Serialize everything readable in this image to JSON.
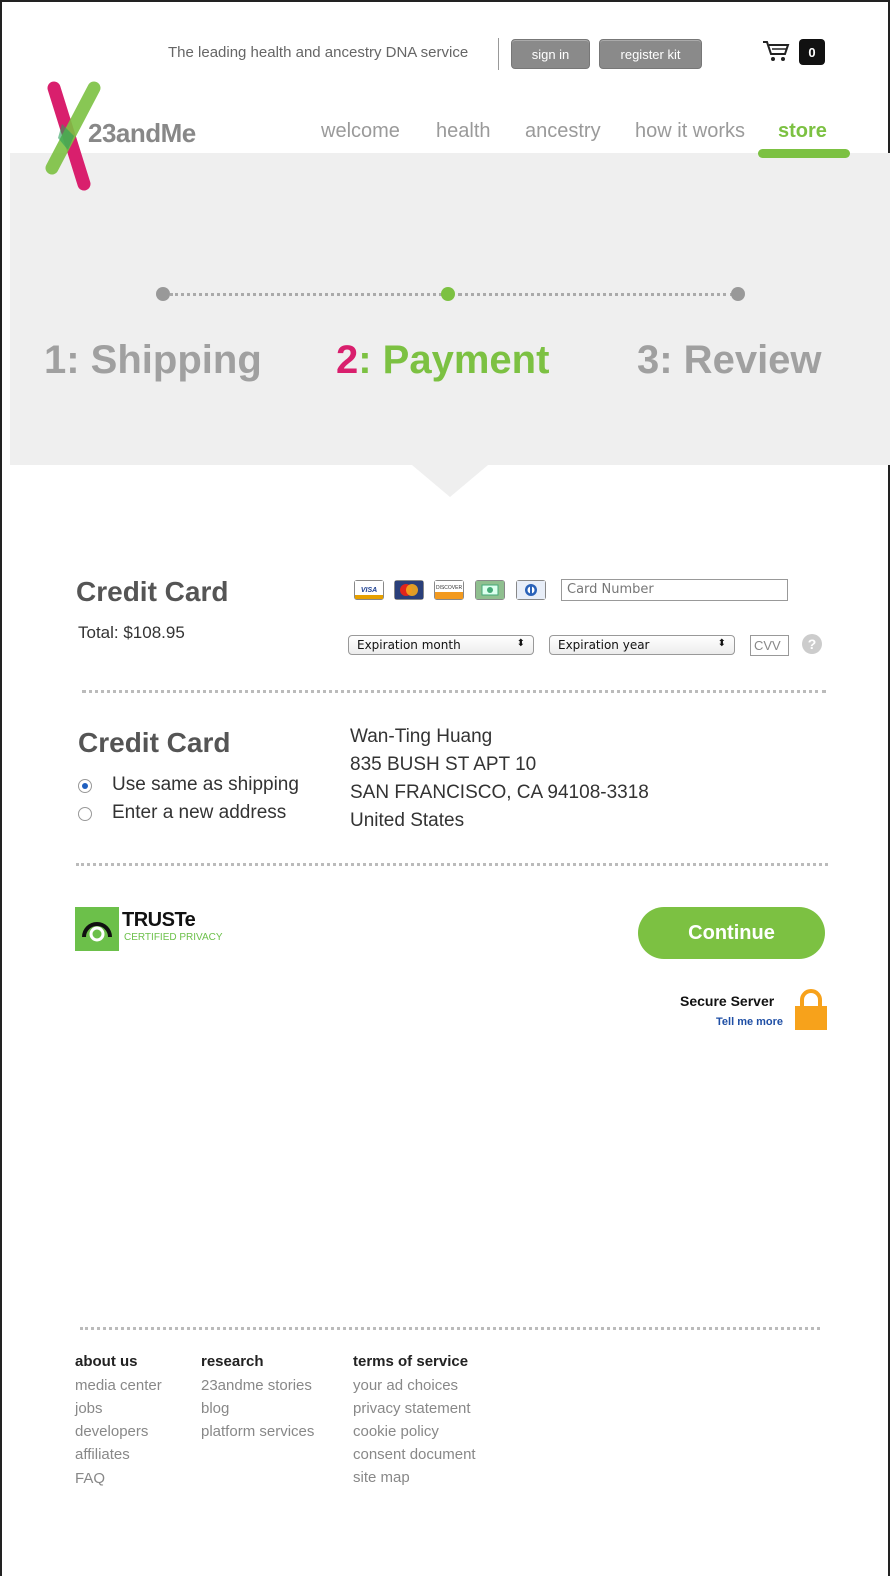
{
  "header": {
    "tagline": "The leading health and ancestry DNA service",
    "sign_in": "sign in",
    "register_kit": "register kit",
    "cart_count": "0",
    "brand": "23andMe"
  },
  "nav": {
    "items": [
      "welcome",
      "health",
      "ancestry",
      "how it works",
      "store"
    ],
    "active": "store"
  },
  "steps": {
    "one_num": "1",
    "one_label": ": Shipping",
    "two_num": "2",
    "two_label": ": Payment",
    "three_num": "3",
    "three_label": ": Review",
    "current": 2
  },
  "payment": {
    "title": "Credit Card",
    "total": "Total: $108.95",
    "card_icons": [
      "visa-icon",
      "mastercard-icon",
      "discover-icon",
      "amex-icon",
      "diners-icon"
    ],
    "card_number_placeholder": "Card Number",
    "exp_month": "Expiration month",
    "exp_year": "Expiration year",
    "cvv_placeholder": "CVV",
    "help": "?"
  },
  "billing": {
    "title": "Credit Card",
    "options": [
      "Use same as shipping",
      "Enter a new address"
    ],
    "selected": "Use same as shipping",
    "address_lines": [
      "Wan-Ting Huang",
      "835 BUSH ST APT 10",
      "SAN FRANCISCO, CA 94108-3318",
      "United States"
    ]
  },
  "truste": {
    "name": "TRUSTe",
    "tagline": "CERTIFIED PRIVACY"
  },
  "actions": {
    "continue": "Continue",
    "secure_server": "Secure Server",
    "tell_me_more": "Tell me more"
  },
  "footer": {
    "col1_head": "about us",
    "col1": [
      "media center",
      "jobs",
      "developers",
      "affiliates",
      "FAQ"
    ],
    "col2_head": "research",
    "col2": [
      "23andme stories",
      "blog",
      "platform services"
    ],
    "col3_head": "terms of service",
    "col3": [
      "your ad choices",
      "privacy statement",
      "cookie policy",
      "consent document",
      "site map"
    ]
  },
  "colors": {
    "brand_green": "#7cc142",
    "brand_pink": "#d91f6d",
    "band_gray": "#efefef"
  }
}
